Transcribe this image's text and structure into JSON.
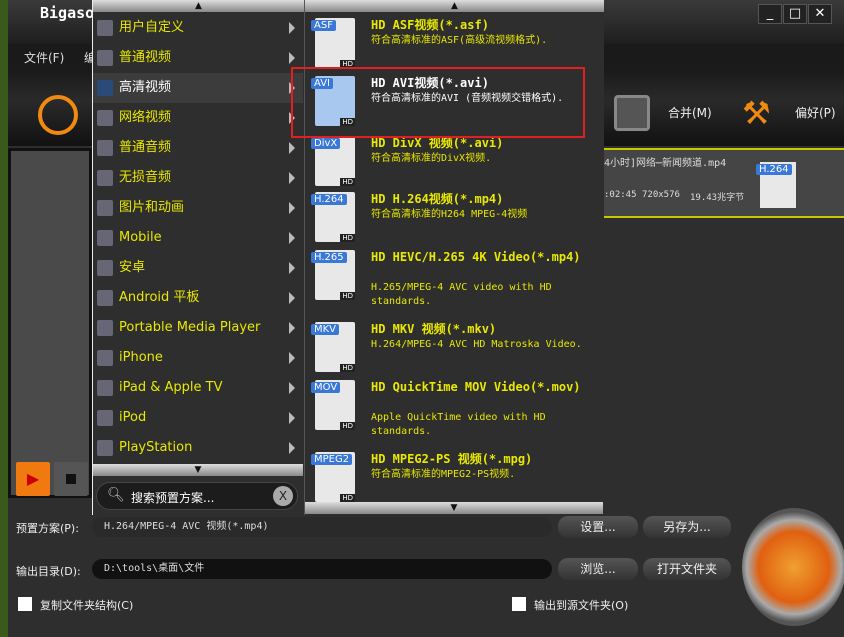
{
  "app": {
    "title": "Bigasoft",
    "menu": [
      "文件(F)",
      "编"
    ],
    "window_controls": [
      "minimize",
      "maximize",
      "close"
    ]
  },
  "toolbar": {
    "merge_label": "合并(M)",
    "prefs_label": "偏好(P)"
  },
  "file": {
    "name": "4小时]网络⋯新闻频道.mp4",
    "duration": ":02:45",
    "resolution": "720x576",
    "size": "19.43兆字节",
    "codec_badge": "H.264"
  },
  "category_menu": {
    "items": [
      {
        "label": "用户自定义",
        "icon": "user-icon"
      },
      {
        "label": "普通视频",
        "icon": "film-icon"
      },
      {
        "label": "高清视频",
        "icon": "hd-icon",
        "selected": true
      },
      {
        "label": "网络视频",
        "icon": "web-video-icon"
      },
      {
        "label": "普通音频",
        "icon": "music-note-icon"
      },
      {
        "label": "无损音频",
        "icon": "lossless-music-icon"
      },
      {
        "label": "图片和动画",
        "icon": "picture-icon"
      },
      {
        "label": "Mobile",
        "icon": "mobile-icon"
      },
      {
        "label": "安卓",
        "icon": "android-icon"
      },
      {
        "label": "Android 平板",
        "icon": "android-tablet-icon"
      },
      {
        "label": "Portable Media Player",
        "icon": "pmp-icon"
      },
      {
        "label": "iPhone",
        "icon": "iphone-icon"
      },
      {
        "label": "iPad & Apple TV",
        "icon": "ipad-icon"
      },
      {
        "label": "iPod",
        "icon": "ipod-icon"
      },
      {
        "label": "PlayStation",
        "icon": "playstation-icon"
      }
    ],
    "search_placeholder": "搜索预置方案..."
  },
  "format_menu": {
    "items": [
      {
        "badge": "ASF",
        "title": "HD ASF视频(*.asf)",
        "desc": "符合高清标准的ASF(高级流视频格式)."
      },
      {
        "badge": "AVI",
        "title": "HD AVI视频(*.avi)",
        "desc": "符合高清标准的AVI (音频视频交错格式).",
        "selected": true
      },
      {
        "badge": "DivX",
        "title": "HD DivX 视频(*.avi)",
        "desc": "符合高清标准的DivX视频."
      },
      {
        "badge": "H.264",
        "title": "HD H.264视频(*.mp4)",
        "desc": "符合高清标准的H264 MPEG-4视频"
      },
      {
        "badge": "H.265",
        "title": "HD HEVC/H.265 4K Video(*.mp4)",
        "desc": "H.265/MPEG-4 AVC video with HD standards."
      },
      {
        "badge": "MKV",
        "title": "HD MKV 视频(*.mkv)",
        "desc": "H.264/MPEG-4 AVC HD Matroska Video."
      },
      {
        "badge": "MOV",
        "title": "HD QuickTime MOV Video(*.mov)",
        "desc": "Apple QuickTime video with HD standards."
      },
      {
        "badge": "MPEG2",
        "title": "HD MPEG2-PS 视频(*.mpg)",
        "desc": "符合高清标准的MPEG2-PS视频."
      }
    ]
  },
  "bottom": {
    "preset_label": "预置方案(P):",
    "preset_value": "H.264/MPEG-4 AVC 视频(*.mp4)",
    "settings_button": "设置...",
    "saveas_button": "另存为...",
    "output_label": "输出目录(D):",
    "output_value": "D:\\tools\\桌面\\文件",
    "browse_button": "浏览...",
    "open_folder_button": "打开文件夹",
    "copy_structure_label": "复制文件夹结构(C)",
    "output_to_source_label": "输出到源文件夹(O)"
  },
  "colors": {
    "menu_text": "#e8e800",
    "highlight_border": "#e02020",
    "accent": "#f07a10"
  }
}
